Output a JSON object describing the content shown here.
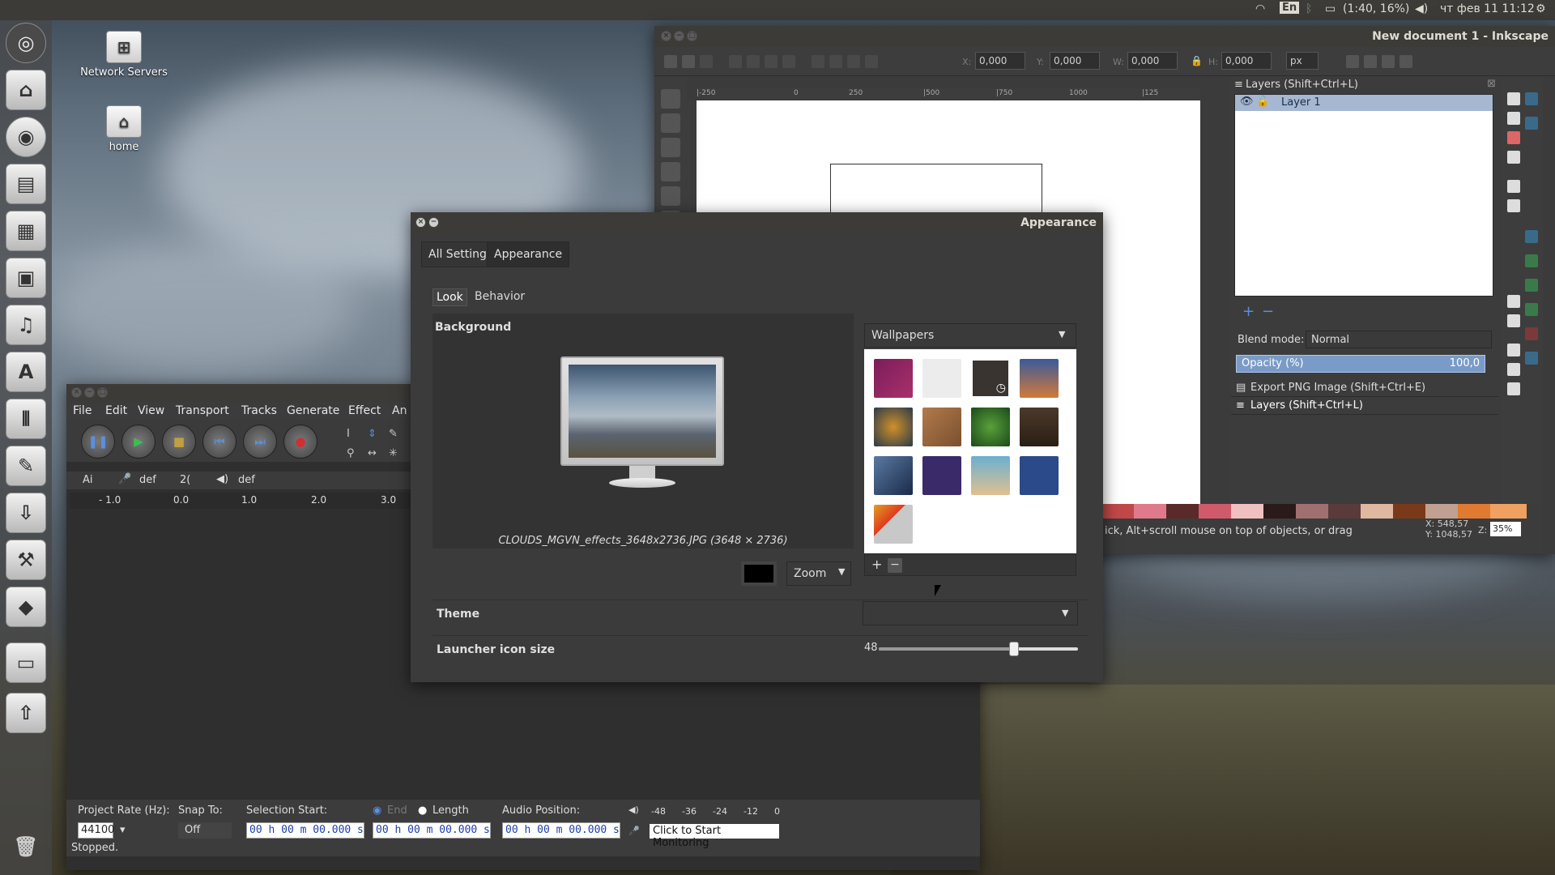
{
  "topbar": {
    "keyboard": "En",
    "battery": "(1:40, 16%)",
    "datetime": "чт фев 11 11:12"
  },
  "desktop": {
    "icons": [
      {
        "label": "Network Servers"
      },
      {
        "label": "home"
      }
    ]
  },
  "inkscape": {
    "title": "New document 1 - Inkscape",
    "x_label": "X:",
    "x_value": "0,000",
    "y_label": "Y:",
    "y_value": "0,000",
    "w_label": "W:",
    "w_value": "0,000",
    "h_label": "H:",
    "h_value": "0,000",
    "unit": "px",
    "ruler_ticks": [
      "|-250",
      "0",
      "250",
      "|500",
      "|750",
      "1000",
      "|125"
    ],
    "layers_panel": {
      "title": "Layers (Shift+Ctrl+L)",
      "layer_name": "Layer 1",
      "blend_label": "Blend mode:",
      "blend_value": "Normal",
      "opacity_label": "Opacity (%)",
      "opacity_value": "100,0",
      "export_label": "Export PNG Image (Shift+Ctrl+E)",
      "layers_tab": "Layers (Shift+Ctrl+L)"
    },
    "statusbar": "ick, Alt+scroll mouse on top of objects, or drag around o...",
    "cursor_x": "X: 548,57",
    "cursor_y": "Y: 1048,57",
    "zoom_label": "Z:",
    "zoom_value": "35%"
  },
  "audacity": {
    "menu": [
      "File",
      "Edit",
      "View",
      "Transport",
      "Tracks",
      "Generate",
      "Effect",
      "An"
    ],
    "device_a": "Ai",
    "device_def1": "def",
    "device_2": "2(",
    "device_def2": "def",
    "timeline": [
      "- 1.0",
      "0.0",
      "1.0",
      "2.0",
      "3.0"
    ],
    "project_rate_label": "Project Rate (Hz):",
    "project_rate_value": "44100",
    "snap_label": "Snap To:",
    "snap_value": "Off",
    "selection_label": "Selection Start:",
    "end_label": "End",
    "length_label": "Length",
    "audio_pos_label": "Audio Position:",
    "time_value": "00 h 00 m 00.000 s",
    "meter_ticks": [
      "-48",
      "-36",
      "-24",
      "-12",
      "0"
    ],
    "monitor_label": "Click to Start Monitoring",
    "status": "Stopped."
  },
  "appearance": {
    "title": "Appearance",
    "breadcrumbs": [
      "All Settings",
      "Appearance"
    ],
    "tabs": [
      "Look",
      "Behavior"
    ],
    "background_label": "Background",
    "wallpaper_file": "CLOUDS_MGVN_effects_3648x2736.JPG (3648 × 2736)",
    "zoom_value": "Zoom",
    "source_value": "Wallpapers",
    "add_label": "+",
    "remove_label": "−",
    "theme_label": "Theme",
    "icon_size_label": "Launcher icon size",
    "icon_size_value": "48",
    "icon_size_fraction": 0.68,
    "thumbnail_colors": [
      "#7c1d5b",
      "#ececec",
      "#3a3430",
      "#d27a3a",
      "#8a5a3a",
      "#b27a4a",
      "#3a7a2a",
      "#4a3a2a",
      "#5a7aa0",
      "#3a2a6a",
      "#6ab0d0",
      "#2a4a8a",
      "#e0a020"
    ]
  }
}
